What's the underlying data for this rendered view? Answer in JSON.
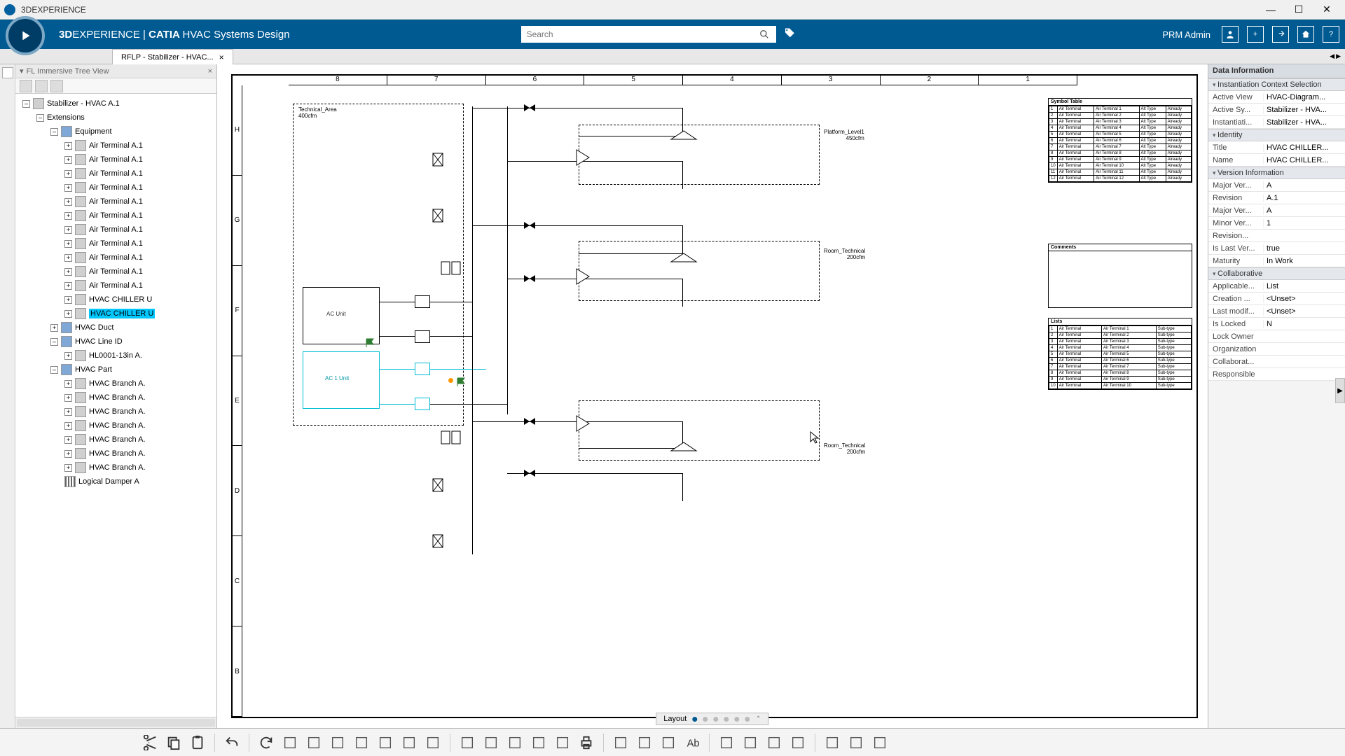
{
  "titlebar": {
    "app": "3DEXPERIENCE"
  },
  "ribbon": {
    "brand_prefix": "3D",
    "brand_main": "EXPERIENCE",
    "brand_sep": " | ",
    "brand_suite": "CATIA ",
    "brand_product": "HVAC Systems Design",
    "search_placeholder": "Search",
    "user": "PRM Admin"
  },
  "tab": {
    "label": "RFLP - Stabilizer - HVAC..."
  },
  "left_panel": {
    "title": "FL Immersive Tree View"
  },
  "tree": {
    "root": "Stabilizer - HVAC A.1",
    "extensions": "Extensions",
    "equipment": "Equipment",
    "air_terminals": [
      "Air Terminal A.1",
      "Air Terminal A.1",
      "Air Terminal A.1",
      "Air Terminal A.1",
      "Air Terminal A.1",
      "Air Terminal A.1",
      "Air Terminal A.1",
      "Air Terminal A.1",
      "Air Terminal A.1",
      "Air Terminal A.1",
      "Air Terminal A.1"
    ],
    "chiller1": "HVAC CHILLER U",
    "chiller2": "HVAC CHILLER U",
    "duct": "HVAC Duct",
    "line_id": "HVAC Line ID",
    "hl": "HL0001-13in A.",
    "part": "HVAC Part",
    "branches": [
      "HVAC Branch A.",
      "HVAC Branch A.",
      "HVAC Branch A.",
      "HVAC Branch A.",
      "HVAC Branch A.",
      "HVAC Branch A.",
      "HVAC Branch A."
    ],
    "damper": "Logical Damper A"
  },
  "ruler_cols": [
    "8",
    "7",
    "6",
    "5",
    "4",
    "3",
    "2",
    "1"
  ],
  "ruler_rows": [
    "H",
    "G",
    "F",
    "E",
    "D",
    "C",
    "B"
  ],
  "zones": {
    "tech_area": "Technical_Area",
    "tech_area_flow": "400cfm",
    "platform": "Platform_Level1",
    "platform_flow": "450cfm",
    "room1": "Room_Technical",
    "room1_flow": "200cfm",
    "room2": "Room_Technical",
    "room2_flow": "200cfm",
    "ac1": "AC Unit",
    "ac2": "AC 1 Unit"
  },
  "right_panel_title": "Data Information",
  "sections": {
    "instantiation": "Instantiation Context Selection",
    "identity": "Identity",
    "version": "Version Information",
    "collab": "Collaborative"
  },
  "props": {
    "active_view_k": "Active View",
    "active_view_v": "HVAC-Diagram...",
    "active_sy_k": "Active Sy...",
    "active_sy_v": "Stabilizer - HVA...",
    "instantiati_k": "Instantiati...",
    "instantiati_v": "Stabilizer - HVA...",
    "title_k": "Title",
    "title_v": "HVAC CHILLER...",
    "name_k": "Name",
    "name_v": "HVAC CHILLER...",
    "major_ver_k": "Major Ver...",
    "major_ver_v": "A",
    "revision_k": "Revision",
    "revision_v": "A.1",
    "major_ver2_k": "Major Ver...",
    "major_ver2_v": "A",
    "minor_ver_k": "Minor Ver...",
    "minor_ver_v": "1",
    "revision2_k": "Revision...",
    "revision2_v": "",
    "islast_k": "Is Last Ver...",
    "islast_v": "true",
    "maturity_k": "Maturity",
    "maturity_v": "In Work",
    "applicable_k": "Applicable...",
    "applicable_v": "List",
    "creation_k": "Creation ...",
    "creation_v": "<Unset>",
    "lastmod_k": "Last modif...",
    "lastmod_v": "<Unset>",
    "locked_k": "Is Locked",
    "locked_v": "N",
    "lockowner_k": "Lock Owner",
    "lockowner_v": "",
    "org_k": "Organization",
    "org_v": "",
    "collab_k": "Collaborat...",
    "collab_v": "",
    "resp_k": "Responsible",
    "resp_v": ""
  },
  "symbol_table": {
    "title": "Symbol Table",
    "comments": "Comments",
    "lists": "Lists"
  },
  "layoutbar": {
    "label": "Layout"
  },
  "tools": [
    "cut",
    "copy",
    "paste",
    "undo",
    "update",
    "view-fit",
    "sheet-view",
    "sheet-format",
    "group",
    "align-nodes",
    "rotate",
    "route",
    "vertical-line",
    "grid",
    "grid-settings",
    "link",
    "link2",
    "print",
    "layers",
    "show-hide",
    "find",
    "text",
    "format",
    "line-tool",
    "image",
    "dimension",
    "table-tool",
    "align",
    "distribute"
  ]
}
